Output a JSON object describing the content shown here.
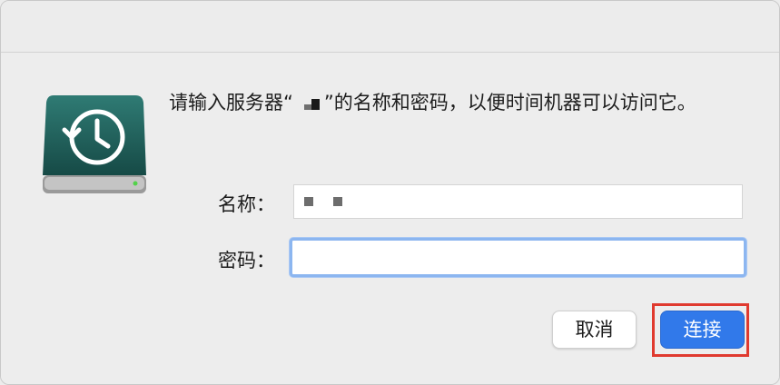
{
  "dialog": {
    "message_part1": "请输入服务器“",
    "message_part2": "”的名称和密码，以便时间机器可以访问它。"
  },
  "icons": {
    "app_icon": "time-machine-drive-icon"
  },
  "form": {
    "name_label": "名称：",
    "password_label": "密码：",
    "name_value": "",
    "password_value": ""
  },
  "buttons": {
    "cancel_label": "取消",
    "connect_label": "连接"
  },
  "colors": {
    "accent": "#3179ea",
    "focus_ring": "#8cb6f0",
    "annotation_box": "#e03a2f",
    "drive_body": "#1f5e5a"
  }
}
